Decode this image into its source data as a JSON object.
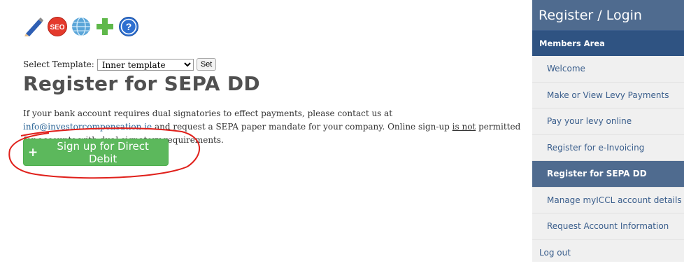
{
  "toolbar": {
    "icons": [
      "pencil-icon",
      "seo-icon",
      "globe-icon",
      "plus-icon",
      "help-icon"
    ],
    "seo_label": "SEO",
    "help_label": "?"
  },
  "template": {
    "label": "Select Template:",
    "selected": "Inner template",
    "set_label": "Set"
  },
  "page": {
    "title": "Register for SEPA DD",
    "intro_1": "If your bank account requires dual signatories to effect payments, please contact us at ",
    "email": "info@investorcompensation.ie",
    "intro_2": " and request a SEPA paper mandate for your company.  Online sign-up ",
    "not_text": "is not",
    "intro_3": " permitted for accounts with dual signatory requirements.",
    "button_icon": "+",
    "button_label": "Sign up for Direct Debit"
  },
  "sidebar": {
    "heading": "Register / Login",
    "section": "Members Area",
    "items": [
      {
        "label": "Welcome"
      },
      {
        "label": "Make or View Levy Payments"
      },
      {
        "label": "Pay your levy online"
      },
      {
        "label": "Register for e-Invoicing"
      },
      {
        "label": "Register for SEPA DD"
      },
      {
        "label": "Manage myICCL account details"
      },
      {
        "label": "Request Account Information"
      }
    ],
    "logout": "Log out"
  },
  "colors": {
    "sidebar_header": "#4f6b8f",
    "sidebar_section": "#2f5382",
    "button_green": "#5cb85c",
    "annotation_red": "#e0201b"
  }
}
